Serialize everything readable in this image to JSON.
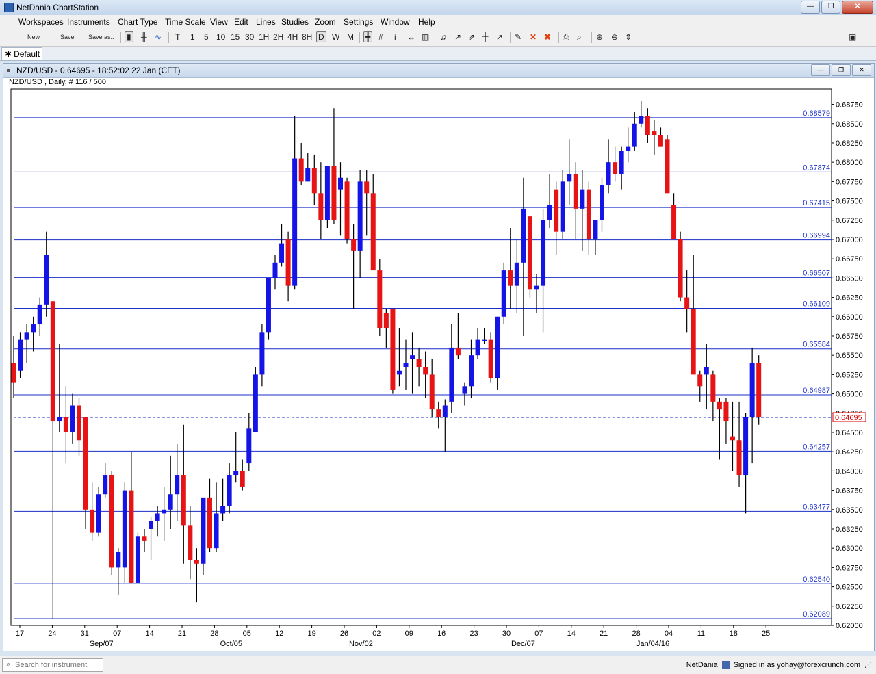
{
  "window": {
    "title": "NetDania ChartStation",
    "controls": [
      "—",
      "❐",
      "✕"
    ]
  },
  "menu": [
    "Workspaces",
    "Instruments",
    "Chart Type",
    "Time Scale",
    "View",
    "Edit",
    "Lines",
    "Studies",
    "Zoom",
    "Settings",
    "Window",
    "Help"
  ],
  "toolbar": {
    "new_label": "New",
    "save_label": "Save",
    "save_as_label": "Save as..",
    "timeframes": [
      "T",
      "1",
      "5",
      "10",
      "15",
      "30",
      "1H",
      "2H",
      "4H",
      "8H",
      "D",
      "W",
      "M"
    ],
    "selected_timeframe": "D"
  },
  "tab": {
    "label": "Default"
  },
  "chart_window": {
    "title": "NZD/USD - 0.64695 - 18:52:02  22 Jan (CET)",
    "subtitle": "NZD/USD , Daily, # 116 / 500"
  },
  "status": {
    "search_placeholder": "Search for instrument",
    "brand": "NetDania",
    "signed_in": "Signed in as yohay@forexcrunch.com"
  },
  "chart_data": {
    "type": "candlestick",
    "instrument": "NZD/USD",
    "period": "Daily",
    "ylim": [
      0.62,
      0.6895
    ],
    "yticks": [
      0.62,
      0.6225,
      0.625,
      0.6275,
      0.63,
      0.6325,
      0.635,
      0.6375,
      0.64,
      0.6425,
      0.645,
      0.6475,
      0.65,
      0.6525,
      0.655,
      0.6575,
      0.66,
      0.6625,
      0.665,
      0.6675,
      0.67,
      0.6725,
      0.675,
      0.6775,
      0.68,
      0.6825,
      0.685,
      0.6875
    ],
    "ytick_labels": [
      "0.62000",
      "0.62250",
      "0.62500",
      "0.62750",
      "0.63000",
      "0.63250",
      "0.63500",
      "0.63750",
      "0.64000",
      "0.64250",
      "0.64500",
      "0.64750",
      "0.65000",
      "0.65250",
      "0.65500",
      "0.65750",
      "0.66000",
      "0.66250",
      "0.66500",
      "0.66750",
      "0.67000",
      "0.67250",
      "0.67500",
      "0.67750",
      "0.68000",
      "0.68250",
      "0.68500",
      "0.68750"
    ],
    "xtick_labels": [
      "17",
      "24",
      "31",
      "07",
      "14",
      "21",
      "28",
      "05",
      "12",
      "19",
      "26",
      "02",
      "09",
      "16",
      "23",
      "30",
      "07",
      "14",
      "21",
      "28",
      "04",
      "11",
      "18",
      "25"
    ],
    "month_labels": [
      {
        "label": "Sep/07",
        "after_tick": 3
      },
      {
        "label": "Oct/05",
        "after_tick": 7
      },
      {
        "label": "Nov/02",
        "after_tick": 11
      },
      {
        "label": "Dec/07",
        "after_tick": 16
      },
      {
        "label": "Jan/04/16",
        "after_tick": 20
      }
    ],
    "horizontal_lines": [
      0.68579,
      0.67874,
      0.67415,
      0.66994,
      0.66507,
      0.66109,
      0.65584,
      0.64987,
      0.64257,
      0.63477,
      0.6254,
      0.62089
    ],
    "current_price": 0.64695,
    "candles": [
      [
        0.654,
        0.6575,
        0.6495,
        0.6515
      ],
      [
        0.653,
        0.658,
        0.652,
        0.657
      ],
      [
        0.657,
        0.659,
        0.654,
        0.658
      ],
      [
        0.658,
        0.66,
        0.6555,
        0.659
      ],
      [
        0.659,
        0.6625,
        0.6575,
        0.6615
      ],
      [
        0.6615,
        0.671,
        0.66,
        0.668
      ],
      [
        0.662,
        0.662,
        0.6208,
        0.6465
      ],
      [
        0.6465,
        0.6565,
        0.645,
        0.647
      ],
      [
        0.647,
        0.651,
        0.641,
        0.645
      ],
      [
        0.645,
        0.65,
        0.6435,
        0.6485
      ],
      [
        0.6485,
        0.6495,
        0.642,
        0.644
      ],
      [
        0.647,
        0.647,
        0.6325,
        0.635
      ],
      [
        0.635,
        0.6385,
        0.631,
        0.632
      ],
      [
        0.632,
        0.638,
        0.6315,
        0.637
      ],
      [
        0.637,
        0.641,
        0.6365,
        0.6395
      ],
      [
        0.6395,
        0.64,
        0.6265,
        0.6275
      ],
      [
        0.6275,
        0.63,
        0.624,
        0.6295
      ],
      [
        0.6275,
        0.6385,
        0.6255,
        0.6375
      ],
      [
        0.6375,
        0.6425,
        0.6255,
        0.6255
      ],
      [
        0.6255,
        0.632,
        0.6255,
        0.6315
      ],
      [
        0.6315,
        0.6325,
        0.6295,
        0.631
      ],
      [
        0.6325,
        0.634,
        0.6285,
        0.6335
      ],
      [
        0.6335,
        0.6355,
        0.6315,
        0.6345
      ],
      [
        0.6345,
        0.638,
        0.631,
        0.635
      ],
      [
        0.635,
        0.642,
        0.6325,
        0.637
      ],
      [
        0.637,
        0.6435,
        0.6335,
        0.6395
      ],
      [
        0.6395,
        0.646,
        0.628,
        0.633
      ],
      [
        0.633,
        0.6355,
        0.626,
        0.6285
      ],
      [
        0.6285,
        0.63,
        0.623,
        0.628
      ],
      [
        0.628,
        0.634,
        0.6265,
        0.6365
      ],
      [
        0.6365,
        0.639,
        0.6295,
        0.63
      ],
      [
        0.63,
        0.6385,
        0.6295,
        0.6345
      ],
      [
        0.6345,
        0.639,
        0.6335,
        0.6355
      ],
      [
        0.6355,
        0.641,
        0.6345,
        0.6395
      ],
      [
        0.6395,
        0.645,
        0.6385,
        0.64
      ],
      [
        0.64,
        0.6415,
        0.6375,
        0.638
      ],
      [
        0.641,
        0.6475,
        0.64,
        0.6455
      ],
      [
        0.645,
        0.6535,
        0.6475,
        0.6525
      ],
      [
        0.6525,
        0.659,
        0.651,
        0.658
      ],
      [
        0.658,
        0.663,
        0.657,
        0.665
      ],
      [
        0.665,
        0.668,
        0.6635,
        0.667
      ],
      [
        0.667,
        0.672,
        0.6665,
        0.6695
      ],
      [
        0.67,
        0.671,
        0.662,
        0.664
      ],
      [
        0.664,
        0.686,
        0.6635,
        0.6805
      ],
      [
        0.6805,
        0.6825,
        0.677,
        0.6775
      ],
      [
        0.6775,
        0.6812,
        0.6785,
        0.6793
      ],
      [
        0.6793,
        0.681,
        0.6745,
        0.676
      ],
      [
        0.676,
        0.68,
        0.67,
        0.6725
      ],
      [
        0.6725,
        0.6795,
        0.6715,
        0.6795
      ],
      [
        0.6795,
        0.687,
        0.672,
        0.6725
      ],
      [
        0.6765,
        0.68,
        0.6705,
        0.678
      ],
      [
        0.6775,
        0.678,
        0.6695,
        0.67
      ],
      [
        0.67,
        0.672,
        0.661,
        0.6685
      ],
      [
        0.6685,
        0.679,
        0.665,
        0.6775
      ],
      [
        0.6775,
        0.679,
        0.6705,
        0.676
      ],
      [
        0.676,
        0.6785,
        0.669,
        0.666
      ],
      [
        0.666,
        0.6675,
        0.6575,
        0.6585
      ],
      [
        0.6605,
        0.661,
        0.656,
        0.6585
      ],
      [
        0.661,
        0.661,
        0.65,
        0.6505
      ],
      [
        0.6525,
        0.6585,
        0.651,
        0.653
      ],
      [
        0.6535,
        0.657,
        0.6505,
        0.654
      ],
      [
        0.6545,
        0.658,
        0.65,
        0.655
      ],
      [
        0.6545,
        0.656,
        0.651,
        0.6535
      ],
      [
        0.6535,
        0.6555,
        0.6495,
        0.6525
      ],
      [
        0.6525,
        0.6545,
        0.647,
        0.648
      ],
      [
        0.648,
        0.649,
        0.6455,
        0.647
      ],
      [
        0.647,
        0.6493,
        0.6425,
        0.6485
      ],
      [
        0.649,
        0.659,
        0.6475,
        0.656
      ],
      [
        0.656,
        0.6605,
        0.6545,
        0.655
      ],
      [
        0.65,
        0.6515,
        0.6485,
        0.651
      ],
      [
        0.651,
        0.657,
        0.6495,
        0.655
      ],
      [
        0.655,
        0.6585,
        0.6545,
        0.657
      ],
      [
        0.657,
        0.6585,
        0.6565,
        0.657
      ],
      [
        0.657,
        0.658,
        0.6515,
        0.652
      ],
      [
        0.652,
        0.66,
        0.6505,
        0.66
      ],
      [
        0.66,
        0.667,
        0.659,
        0.666
      ],
      [
        0.666,
        0.6715,
        0.661,
        0.664
      ],
      [
        0.664,
        0.67,
        0.6605,
        0.667
      ],
      [
        0.667,
        0.678,
        0.6575,
        0.674
      ],
      [
        0.673,
        0.673,
        0.6625,
        0.6635
      ],
      [
        0.6635,
        0.6655,
        0.6605,
        0.664
      ],
      [
        0.664,
        0.674,
        0.658,
        0.6725
      ],
      [
        0.6725,
        0.6785,
        0.6715,
        0.6745
      ],
      [
        0.6765,
        0.6775,
        0.668,
        0.671
      ],
      [
        0.671,
        0.679,
        0.67,
        0.6775
      ],
      [
        0.6775,
        0.683,
        0.6745,
        0.6785
      ],
      [
        0.6785,
        0.68,
        0.67,
        0.674
      ],
      [
        0.674,
        0.679,
        0.6685,
        0.6765
      ],
      [
        0.6765,
        0.6775,
        0.668,
        0.67
      ],
      [
        0.67,
        0.6715,
        0.668,
        0.6725
      ],
      [
        0.6725,
        0.678,
        0.671,
        0.677
      ],
      [
        0.677,
        0.683,
        0.676,
        0.68
      ],
      [
        0.68,
        0.682,
        0.6775,
        0.6785
      ],
      [
        0.6785,
        0.682,
        0.6765,
        0.6815
      ],
      [
        0.6815,
        0.6845,
        0.68,
        0.682
      ],
      [
        0.682,
        0.6865,
        0.6815,
        0.685
      ],
      [
        0.685,
        0.688,
        0.6845,
        0.686
      ],
      [
        0.686,
        0.687,
        0.6825,
        0.6835
      ],
      [
        0.684,
        0.6855,
        0.681,
        0.6835
      ],
      [
        0.6835,
        0.6845,
        0.682,
        0.682
      ],
      [
        0.683,
        0.6835,
        0.676,
        0.676
      ],
      [
        0.6745,
        0.676,
        0.67,
        0.67
      ],
      [
        0.67,
        0.671,
        0.662,
        0.6625
      ],
      [
        0.6625,
        0.666,
        0.658,
        0.661
      ],
      [
        0.661,
        0.668,
        0.6545,
        0.6525
      ],
      [
        0.6525,
        0.653,
        0.649,
        0.651
      ],
      [
        0.6525,
        0.6565,
        0.648,
        0.6535
      ],
      [
        0.6525,
        0.653,
        0.6465,
        0.649
      ],
      [
        0.649,
        0.6495,
        0.6415,
        0.648
      ],
      [
        0.649,
        0.6495,
        0.6435,
        0.6465
      ],
      [
        0.6445,
        0.649,
        0.64,
        0.644
      ],
      [
        0.644,
        0.649,
        0.638,
        0.6395
      ],
      [
        0.6395,
        0.6475,
        0.6345,
        0.647
      ],
      [
        0.647,
        0.656,
        0.641,
        0.654
      ],
      [
        0.654,
        0.655,
        0.646,
        0.647
      ]
    ]
  }
}
